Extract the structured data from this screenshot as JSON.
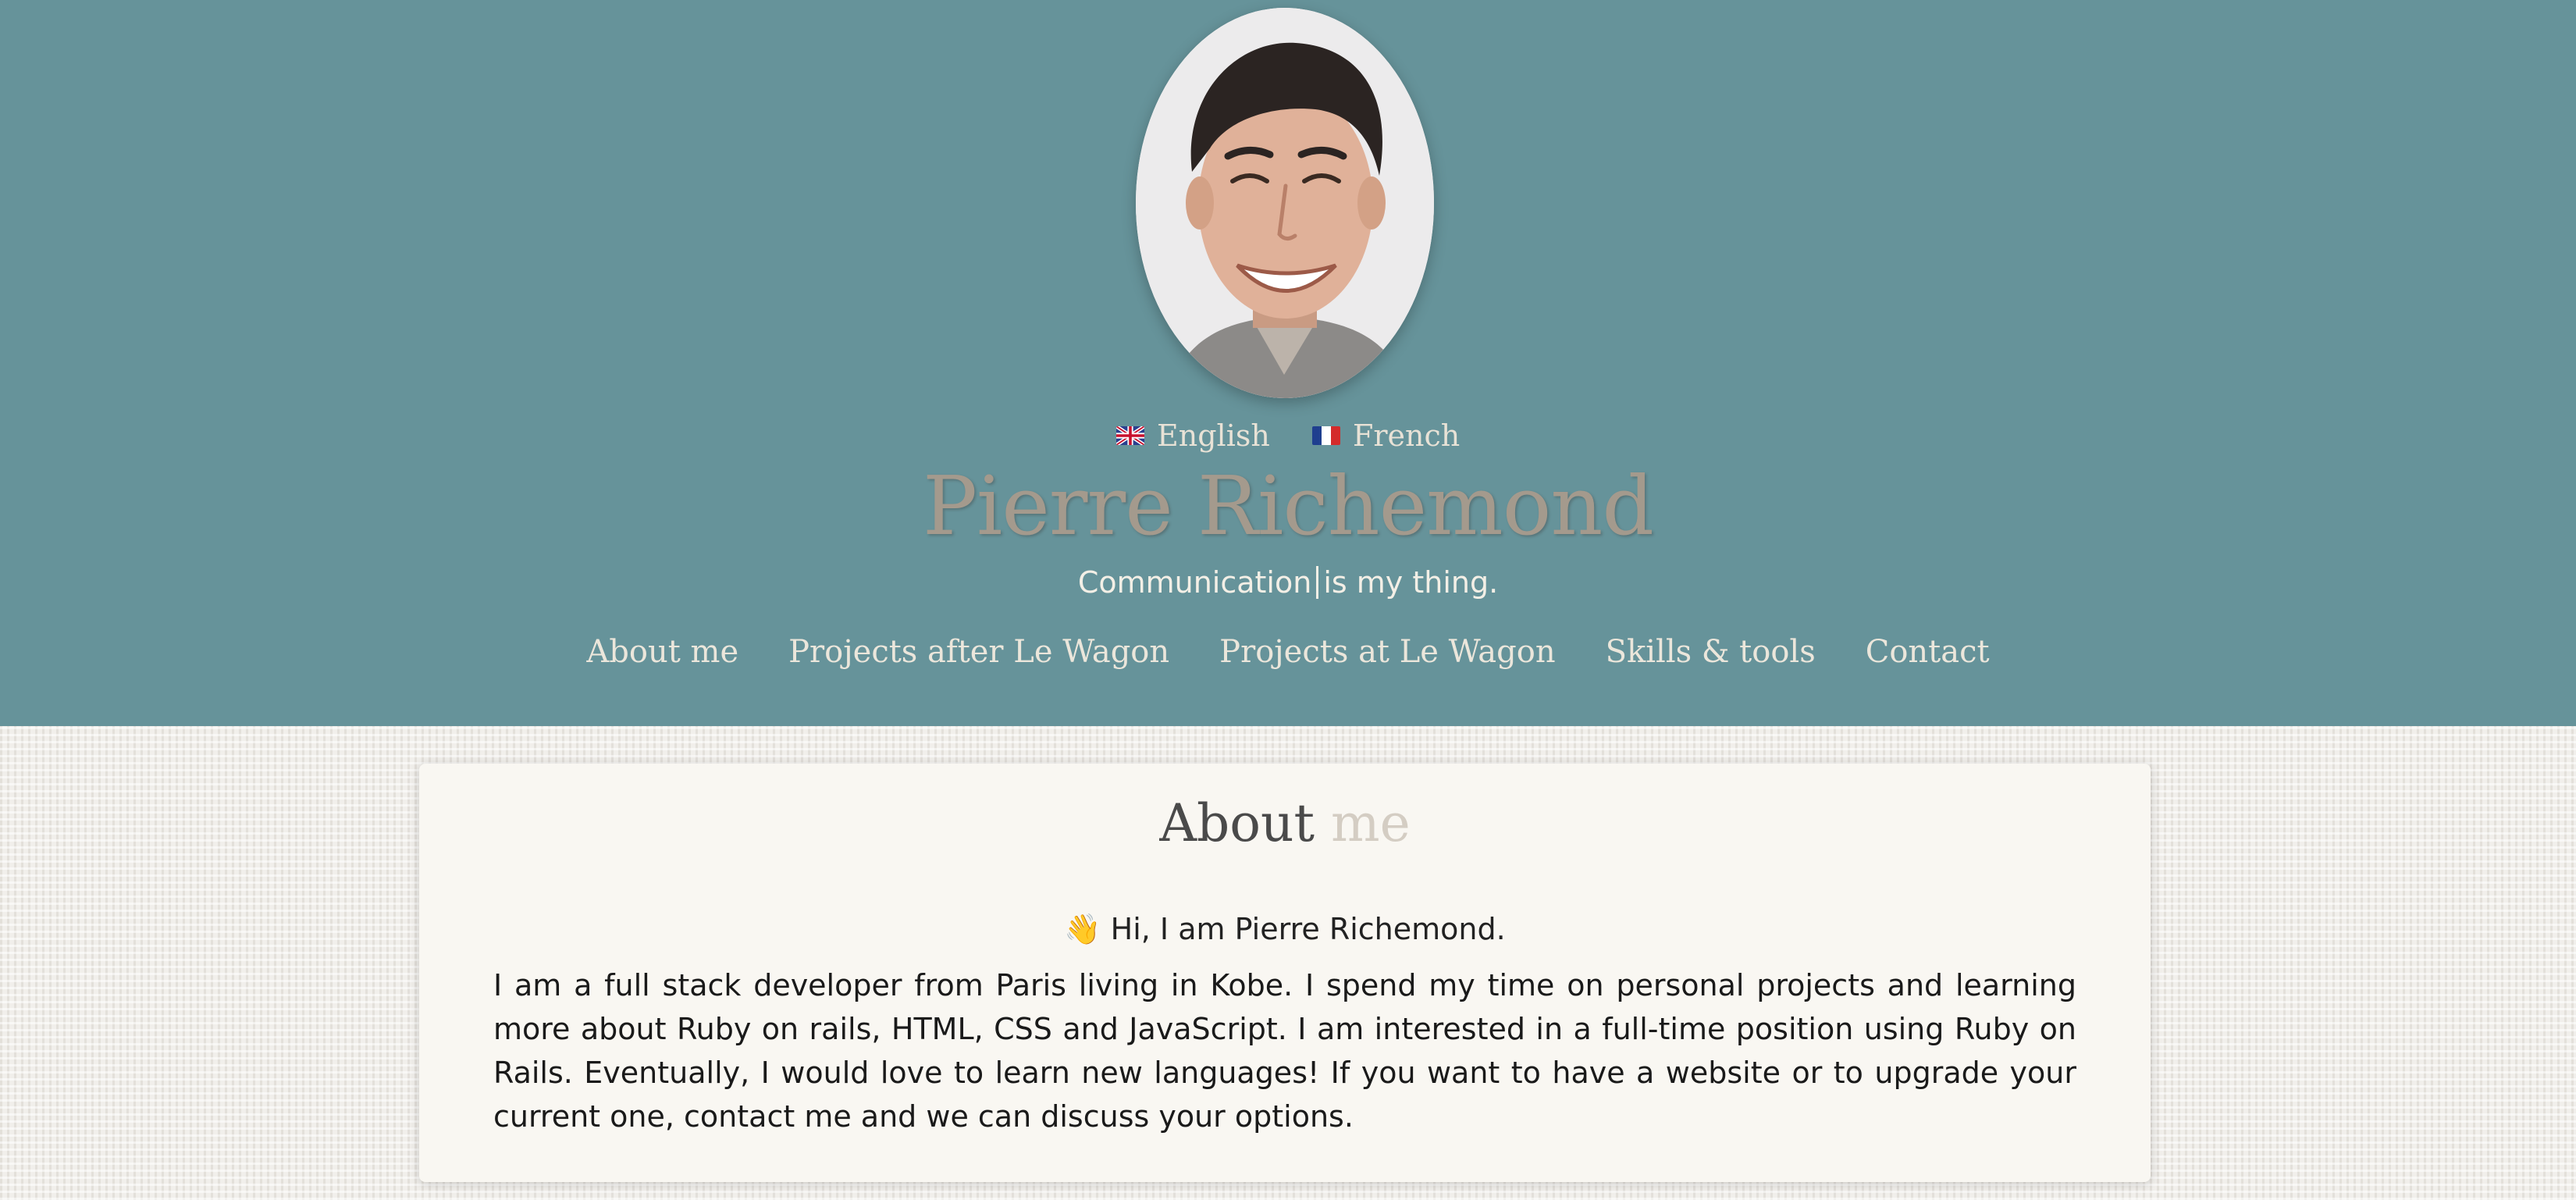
{
  "header": {
    "name": "Pierre Richemond",
    "tagline_part1": "Communication",
    "tagline_part2": "is my thing.",
    "background_color": "#66939a",
    "languages": [
      {
        "label": "English",
        "icon": "uk-flag-icon"
      },
      {
        "label": "French",
        "icon": "france-flag-icon"
      }
    ],
    "nav": [
      {
        "label": "About me"
      },
      {
        "label": "Projects after Le Wagon"
      },
      {
        "label": "Projects at Le Wagon"
      },
      {
        "label": "Skills & tools"
      },
      {
        "label": "Contact"
      }
    ]
  },
  "about": {
    "title_part1": "About",
    "title_part2": "me",
    "greeting": "Hi, I am Pierre Richemond.",
    "greeting_icon": "👋",
    "bio": "I am a full stack developer from Paris living in Kobe. I spend my time on personal projects and learning more about Ruby on rails, HTML, CSS and JavaScript. I am interested in a full-time position using Ruby on Rails. Eventually, I would love to learn new languages! If you want to have a website or to upgrade your current one, contact me and we can discuss your options."
  }
}
